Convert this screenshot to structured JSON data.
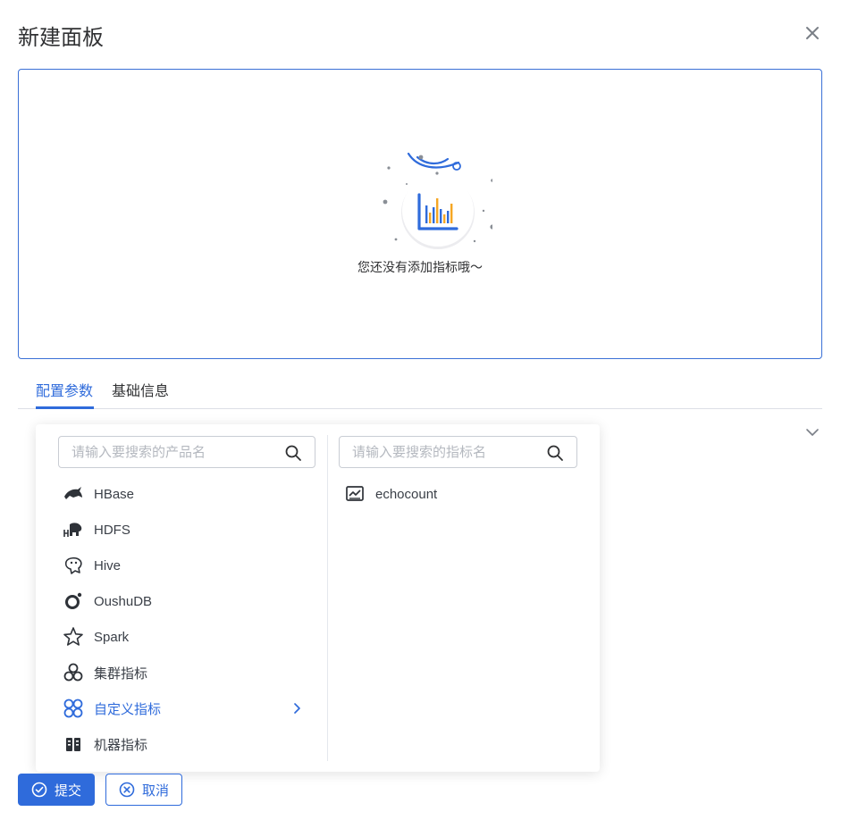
{
  "dialog": {
    "title": "新建面板",
    "close_icon": "close-icon"
  },
  "preview": {
    "empty_text": "您还没有添加指标哦～",
    "illustration_icon": "bar-chart-icon"
  },
  "tabs": [
    {
      "label": "配置参数",
      "active": true
    },
    {
      "label": "基础信息",
      "active": false
    }
  ],
  "cascader": {
    "product_search": {
      "placeholder": "请输入要搜索的产品名",
      "value": ""
    },
    "metric_search": {
      "placeholder": "请输入要搜索的指标名",
      "value": ""
    },
    "products": [
      {
        "label": "HBase",
        "icon": "hbase-orca-icon"
      },
      {
        "label": "HDFS",
        "icon": "hdfs-elephant-icon"
      },
      {
        "label": "Hive",
        "icon": "hive-bee-icon"
      },
      {
        "label": "OushuDB",
        "icon": "oushudb-ring-icon"
      },
      {
        "label": "Spark",
        "icon": "spark-star-icon"
      },
      {
        "label": "集群指标",
        "icon": "cluster-circles-icon"
      },
      {
        "label": "自定义指标",
        "icon": "custom-cloverleaf-icon",
        "active": true
      },
      {
        "label": "机器指标",
        "icon": "server-rack-icon"
      }
    ],
    "metrics": [
      {
        "label": "echocount",
        "icon": "line-chart-icon"
      }
    ]
  },
  "footer": {
    "submit_label": "提交",
    "cancel_label": "取消"
  },
  "colors": {
    "accent": "#2f6bdb",
    "chart_orange": "#f5a623",
    "text": "#303133"
  }
}
